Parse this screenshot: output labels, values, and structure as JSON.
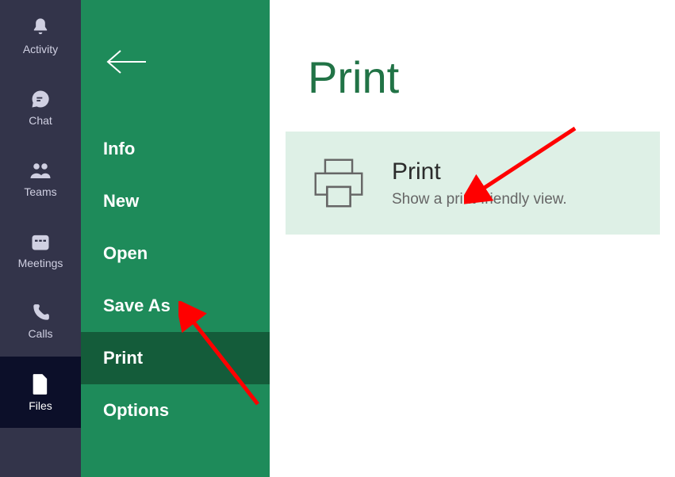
{
  "rail": {
    "items": [
      {
        "id": "activity",
        "label": "Activity",
        "icon": "bell-icon",
        "active": false
      },
      {
        "id": "chat",
        "label": "Chat",
        "icon": "chat-icon",
        "active": false
      },
      {
        "id": "teams",
        "label": "Teams",
        "icon": "people-icon",
        "active": false
      },
      {
        "id": "meetings",
        "label": "Meetings",
        "icon": "calendar-icon",
        "active": false
      },
      {
        "id": "calls",
        "label": "Calls",
        "icon": "phone-icon",
        "active": false
      },
      {
        "id": "files",
        "label": "Files",
        "icon": "file-icon",
        "active": true
      }
    ]
  },
  "backstage": {
    "items": [
      {
        "id": "info",
        "label": "Info",
        "active": false
      },
      {
        "id": "new",
        "label": "New",
        "active": false
      },
      {
        "id": "open",
        "label": "Open",
        "active": false
      },
      {
        "id": "saveas",
        "label": "Save As",
        "active": false
      },
      {
        "id": "print",
        "label": "Print",
        "active": true
      },
      {
        "id": "options",
        "label": "Options",
        "active": false
      }
    ]
  },
  "main": {
    "page_title": "Print",
    "print_card": {
      "title": "Print",
      "subtitle": "Show a print-friendly view."
    }
  },
  "colors": {
    "rail_bg": "#33344a",
    "rail_active_bg": "#0c0f29",
    "backstage_bg": "#1e8b5a",
    "backstage_active_bg": "#145c3a",
    "page_title": "#217346",
    "card_bg": "#def0e6",
    "annotation": "#ff0000"
  }
}
